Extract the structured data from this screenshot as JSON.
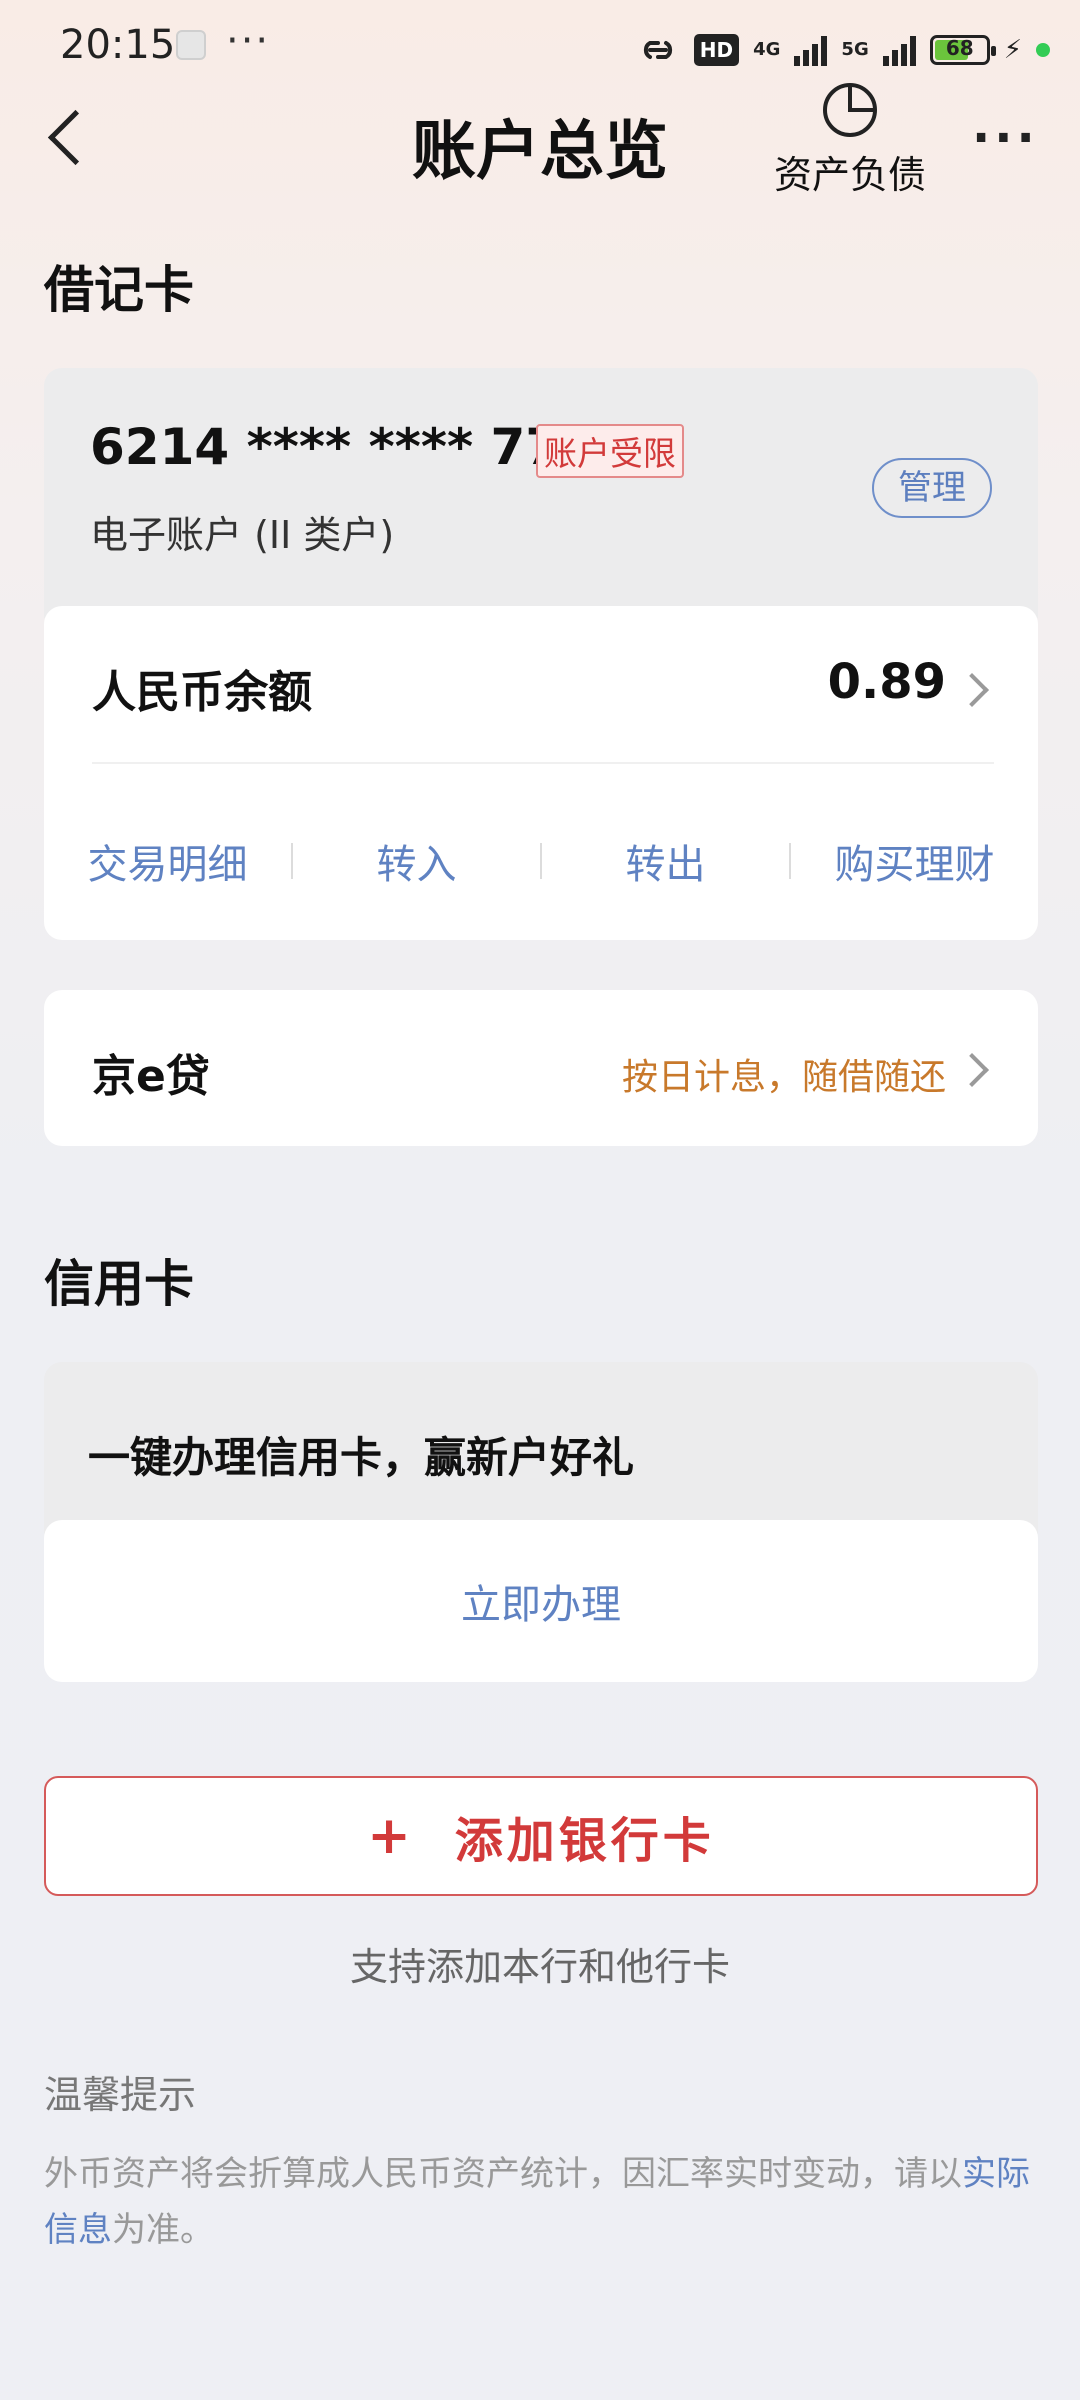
{
  "status_bar": {
    "time": "20:15",
    "more": "···",
    "hd": "HD",
    "net1": "4G",
    "net2": "5G",
    "battery": "68"
  },
  "header": {
    "title": "账户总览",
    "assets_label": "资产负债",
    "more": "···"
  },
  "debit": {
    "section_title": "借记卡",
    "card_number": "6214 **** **** 7736",
    "restricted_badge": "账户受限",
    "account_type": "电子账户 (II 类户)",
    "manage_label": "管理",
    "balance_label": "人民币余额",
    "balance_value": "0.89",
    "actions": [
      "交易明细",
      "转入",
      "转出",
      "购买理财"
    ]
  },
  "loan": {
    "label": "京e贷",
    "desc": "按日计息，随借随还"
  },
  "credit": {
    "section_title": "信用卡",
    "promo": "一键办理信用卡，赢新户好礼",
    "apply_label": "立即办理"
  },
  "add_card": {
    "plus": "+",
    "label": "添加银行卡",
    "support": "支持添加本行和他行卡"
  },
  "tips": {
    "title": "温馨提示",
    "text_before": "外币资产将会折算成人民币资产统计，因汇率实时变动，请以",
    "link": "实际信息",
    "text_after": "为准。"
  },
  "colors": {
    "accent_blue": "#5f82c2",
    "alert_red": "#d23a3a",
    "loan_orange": "#c8792b"
  }
}
